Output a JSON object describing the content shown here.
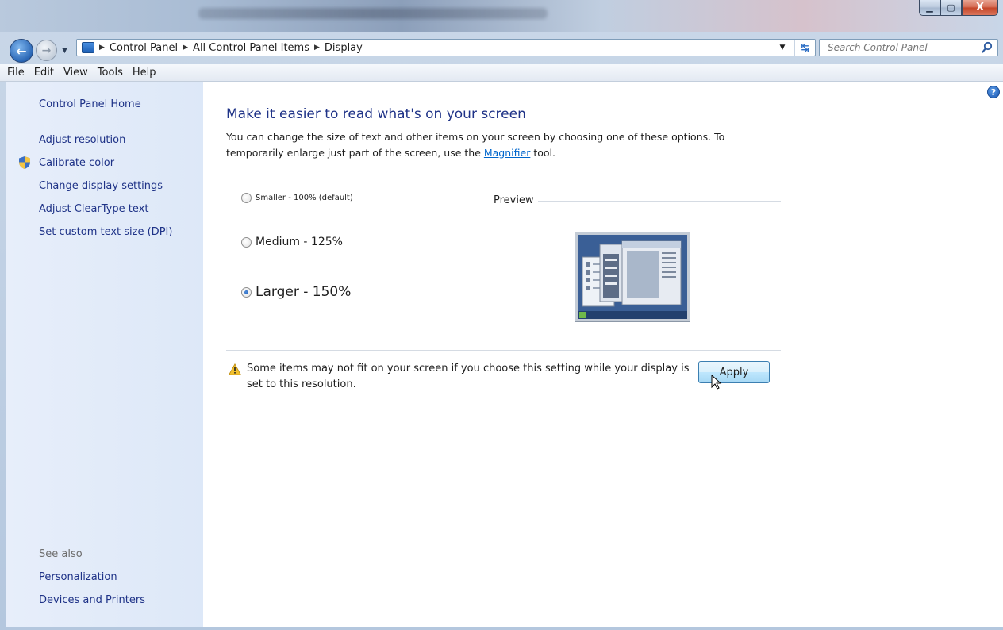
{
  "window": {
    "minimize_glyph": "▁",
    "maximize_glyph": "▢",
    "close_glyph": "X"
  },
  "nav": {
    "breadcrumbs": [
      "Control Panel",
      "All Control Panel Items",
      "Display"
    ],
    "search_placeholder": "Search Control Panel"
  },
  "menu": [
    "File",
    "Edit",
    "View",
    "Tools",
    "Help"
  ],
  "sidebar": {
    "home": "Control Panel Home",
    "links": [
      "Adjust resolution",
      "Calibrate color",
      "Change display settings",
      "Adjust ClearType text",
      "Set custom text size (DPI)"
    ],
    "see_also_label": "See also",
    "see_also": [
      "Personalization",
      "Devices and Printers"
    ]
  },
  "main": {
    "title": "Make it easier to read what's on your screen",
    "desc_part1": "You can change the size of text and other items on your screen by choosing one of these options. To temporarily enlarge just part of the screen, use the ",
    "desc_link": "Magnifier",
    "desc_part2": " tool.",
    "options": [
      {
        "label": "Smaller - 100% (default)",
        "checked": false
      },
      {
        "label": "Medium - 125%",
        "checked": false
      },
      {
        "label": "Larger - 150%",
        "checked": true
      }
    ],
    "preview_label": "Preview",
    "warning": "Some items may not fit on your screen if you choose this setting while your display is set to this resolution.",
    "apply_label": "Apply"
  },
  "colors": {
    "link": "#1e3287",
    "sidebar_bg": "#dde8f8",
    "accent": "#2a67b6"
  }
}
